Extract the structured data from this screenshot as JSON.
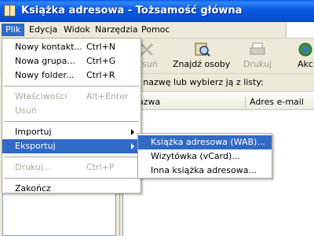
{
  "window": {
    "title": "Książka adresowa - Tożsamość główna"
  },
  "menubar": {
    "items": [
      {
        "label": "Plik",
        "active": true
      },
      {
        "label": "Edycja"
      },
      {
        "label": "Widok"
      },
      {
        "label": "Narzędzia"
      },
      {
        "label": "Pomoc"
      }
    ]
  },
  "toolbar": {
    "delete_label": "Usuń",
    "find_label": "Znajdź osoby",
    "print_label": "Drukuj",
    "action_label": "Akc"
  },
  "hint": {
    "text": "z nazwę lub wybierz ją z listy:"
  },
  "list": {
    "columns": [
      {
        "label": "azwa"
      },
      {
        "label": "Adres e-mail"
      }
    ]
  },
  "file_menu": {
    "new_contact": {
      "label": "Nowy kontakt...",
      "shortcut": "Ctrl+N"
    },
    "new_group": {
      "label": "Nowa grupa...",
      "shortcut": "Ctrl+G"
    },
    "new_folder": {
      "label": "Nowy folder...",
      "shortcut": "Ctrl+R"
    },
    "properties": {
      "label": "Właściwości",
      "shortcut": "Alt+Enter"
    },
    "delete": {
      "label": "Usuń"
    },
    "import": {
      "label": "Importuj"
    },
    "export": {
      "label": "Eksportuj"
    },
    "print": {
      "label": "Drukuj...",
      "shortcut": "Ctrl+P"
    },
    "exit": {
      "label": "Zakończ"
    }
  },
  "export_submenu": {
    "items": [
      {
        "label": "Książka adresowa (WAB)..."
      },
      {
        "label": "Wizytówka (vCard)..."
      },
      {
        "label": "Inna książka adresowa..."
      }
    ]
  },
  "colors": {
    "highlight": "#316ac5",
    "title_bar": "#0553d7",
    "menu_background": "#ffffff",
    "chrome": "#ece9d8"
  },
  "icons": [
    "book-icon",
    "delete-icon",
    "find-people-icon",
    "print-icon",
    "action-icon"
  ]
}
